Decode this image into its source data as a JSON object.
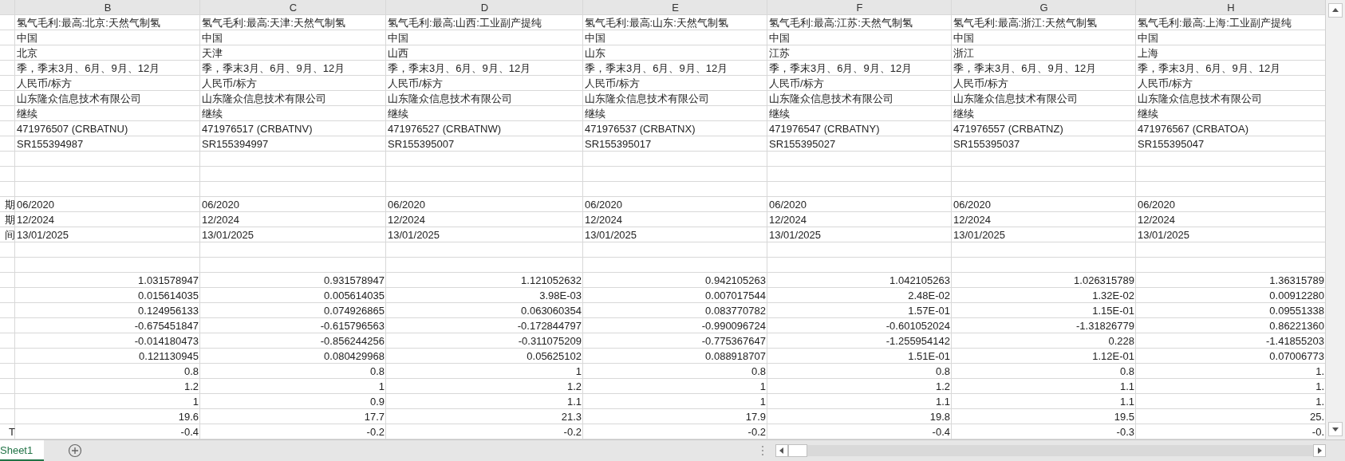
{
  "columns": [
    "B",
    "C",
    "D",
    "E",
    "F",
    "G",
    "H"
  ],
  "rows": [
    {
      "kind": "text",
      "cells": [
        "氢气毛利:最高:北京:天然气制氢",
        "氢气毛利:最高:天津:天然气制氢",
        "氢气毛利:最高:山西:工业副产提纯",
        "氢气毛利:最高:山东:天然气制氢",
        "氢气毛利:最高:江苏:天然气制氢",
        "氢气毛利:最高:浙江:天然气制氢",
        "氢气毛利:最高:上海:工业副产提纯"
      ]
    },
    {
      "kind": "text",
      "cells": [
        "中国",
        "中国",
        "中国",
        "中国",
        "中国",
        "中国",
        "中国"
      ]
    },
    {
      "kind": "text",
      "cells": [
        "北京",
        "天津",
        "山西",
        "山东",
        "江苏",
        "浙江",
        "上海"
      ]
    },
    {
      "kind": "text",
      "cells": [
        "季，季末3月、6月、9月、12月",
        "季，季末3月、6月、9月、12月",
        "季，季末3月、6月、9月、12月",
        "季，季末3月、6月、9月、12月",
        "季，季末3月、6月、9月、12月",
        "季，季末3月、6月、9月、12月",
        "季，季末3月、6月、9月、12月"
      ]
    },
    {
      "kind": "text",
      "cells": [
        "人民币/标方",
        "人民币/标方",
        "人民币/标方",
        "人民币/标方",
        "人民币/标方",
        "人民币/标方",
        "人民币/标方"
      ]
    },
    {
      "kind": "text",
      "cells": [
        "山东隆众信息技术有限公司",
        "山东隆众信息技术有限公司",
        "山东隆众信息技术有限公司",
        "山东隆众信息技术有限公司",
        "山东隆众信息技术有限公司",
        "山东隆众信息技术有限公司",
        "山东隆众信息技术有限公司"
      ]
    },
    {
      "kind": "text",
      "cells": [
        "继续",
        "继续",
        "继续",
        "继续",
        "继续",
        "继续",
        "继续"
      ]
    },
    {
      "kind": "text",
      "cells": [
        "471976507 (CRBATNU)",
        "471976517 (CRBATNV)",
        "471976527 (CRBATNW)",
        "471976537 (CRBATNX)",
        "471976547 (CRBATNY)",
        "471976557 (CRBATNZ)",
        "471976567 (CRBATOA)"
      ]
    },
    {
      "kind": "text",
      "cells": [
        "SR155394987",
        "SR155394997",
        "SR155395007",
        "SR155395017",
        "SR155395027",
        "SR155395037",
        "SR155395047"
      ]
    },
    {
      "kind": "blank"
    },
    {
      "kind": "blank"
    },
    {
      "kind": "blank"
    },
    {
      "kind": "text",
      "row_label": "期",
      "cells": [
        "06/2020",
        "06/2020",
        "06/2020",
        "06/2020",
        "06/2020",
        "06/2020",
        "06/2020"
      ]
    },
    {
      "kind": "text",
      "row_label": "期",
      "cells": [
        "12/2024",
        "12/2024",
        "12/2024",
        "12/2024",
        "12/2024",
        "12/2024",
        "12/2024"
      ]
    },
    {
      "kind": "text",
      "row_label": "间",
      "cells": [
        "13/01/2025",
        "13/01/2025",
        "13/01/2025",
        "13/01/2025",
        "13/01/2025",
        "13/01/2025",
        "13/01/2025"
      ]
    },
    {
      "kind": "blank"
    },
    {
      "kind": "blank"
    },
    {
      "kind": "number",
      "cells": [
        "1.031578947",
        "0.931578947",
        "1.121052632",
        "0.942105263",
        "1.042105263",
        "1.026315789",
        "1.36315789"
      ]
    },
    {
      "kind": "number",
      "cells": [
        "0.015614035",
        "0.005614035",
        "3.98E-03",
        "0.007017544",
        "2.48E-02",
        "1.32E-02",
        "0.00912280"
      ]
    },
    {
      "kind": "number",
      "cells": [
        "0.124956133",
        "0.074926865",
        "0.063060354",
        "0.083770782",
        "1.57E-01",
        "1.15E-01",
        "0.09551338"
      ]
    },
    {
      "kind": "number",
      "cells": [
        "-0.675451847",
        "-0.615796563",
        "-0.172844797",
        "-0.990096724",
        "-0.601052024",
        "-1.31826779",
        "0.86221360"
      ]
    },
    {
      "kind": "number",
      "cells": [
        "-0.014180473",
        "-0.856244256",
        "-0.311075209",
        "-0.775367647",
        "-1.255954142",
        "0.228",
        "-1.41855203"
      ]
    },
    {
      "kind": "number",
      "cells": [
        "0.121130945",
        "0.080429968",
        "0.05625102",
        "0.088918707",
        "1.51E-01",
        "1.12E-01",
        "0.07006773"
      ]
    },
    {
      "kind": "number",
      "cells": [
        "0.8",
        "0.8",
        "1",
        "0.8",
        "0.8",
        "0.8",
        "1."
      ]
    },
    {
      "kind": "number",
      "cells": [
        "1.2",
        "1",
        "1.2",
        "1",
        "1.2",
        "1.1",
        "1."
      ]
    },
    {
      "kind": "number",
      "cells": [
        "1",
        "0.9",
        "1.1",
        "1",
        "1.1",
        "1.1",
        "1."
      ]
    },
    {
      "kind": "number",
      "cells": [
        "19.6",
        "17.7",
        "21.3",
        "17.9",
        "19.8",
        "19.5",
        "25."
      ]
    },
    {
      "kind": "number",
      "row_label": "T",
      "cells": [
        "-0.4",
        "-0.2",
        "-0.2",
        "-0.2",
        "-0.4",
        "-0.3",
        "-0."
      ]
    }
  ],
  "sheet_tabs": [
    {
      "label": "Sheet1",
      "selected": true
    }
  ]
}
